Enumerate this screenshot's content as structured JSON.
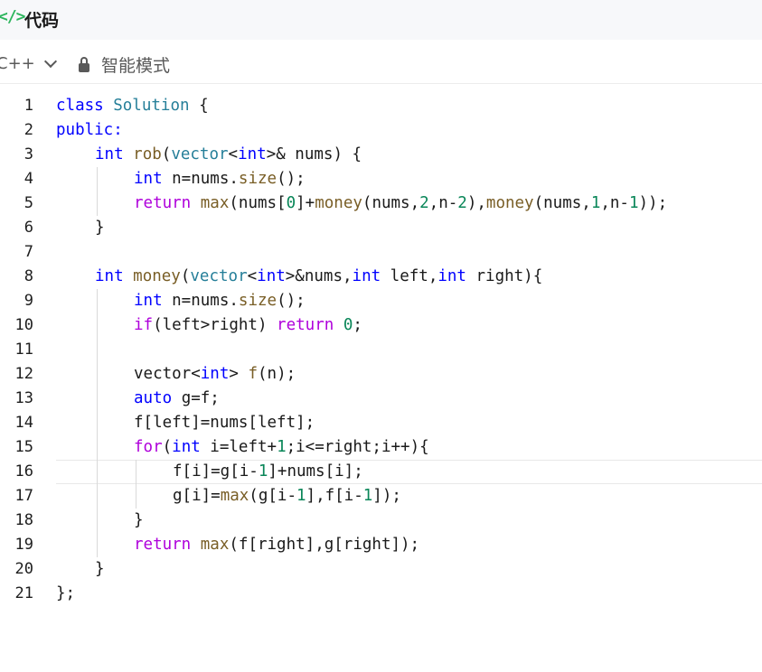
{
  "header": {
    "icon_glyph": "</>",
    "title": "代码"
  },
  "toolbar": {
    "language": "C++",
    "mode_label": "智能模式"
  },
  "editor": {
    "active_line": 16,
    "lines": [
      {
        "num": "1",
        "indent": 0,
        "tokens": [
          [
            "k",
            "class"
          ],
          [
            "p",
            " "
          ],
          [
            "t",
            "Solution"
          ],
          [
            "p",
            " {"
          ]
        ]
      },
      {
        "num": "2",
        "indent": 0,
        "tokens": [
          [
            "k",
            "public:"
          ]
        ]
      },
      {
        "num": "3",
        "indent": 1,
        "tokens": [
          [
            "k",
            "int"
          ],
          [
            "p",
            " "
          ],
          [
            "f",
            "rob"
          ],
          [
            "p",
            "("
          ],
          [
            "t",
            "vector"
          ],
          [
            "p",
            "<"
          ],
          [
            "k",
            "int"
          ],
          [
            "p",
            ">& nums) {"
          ]
        ]
      },
      {
        "num": "4",
        "indent": 2,
        "tokens": [
          [
            "k",
            "int"
          ],
          [
            "p",
            " n=nums."
          ],
          [
            "f",
            "size"
          ],
          [
            "p",
            "();"
          ]
        ]
      },
      {
        "num": "5",
        "indent": 2,
        "tokens": [
          [
            "c",
            "return"
          ],
          [
            "p",
            " "
          ],
          [
            "f",
            "max"
          ],
          [
            "p",
            "(nums["
          ],
          [
            "n",
            "0"
          ],
          [
            "p",
            "]+"
          ],
          [
            "f",
            "money"
          ],
          [
            "p",
            "(nums,"
          ],
          [
            "n",
            "2"
          ],
          [
            "p",
            ",n-"
          ],
          [
            "n",
            "2"
          ],
          [
            "p",
            "),"
          ],
          [
            "f",
            "money"
          ],
          [
            "p",
            "(nums,"
          ],
          [
            "n",
            "1"
          ],
          [
            "p",
            ",n-"
          ],
          [
            "n",
            "1"
          ],
          [
            "p",
            "));"
          ]
        ]
      },
      {
        "num": "6",
        "indent": 1,
        "tokens": [
          [
            "p",
            "}"
          ]
        ]
      },
      {
        "num": "7",
        "indent": 0,
        "tokens": []
      },
      {
        "num": "8",
        "indent": 1,
        "tokens": [
          [
            "k",
            "int"
          ],
          [
            "p",
            " "
          ],
          [
            "f",
            "money"
          ],
          [
            "p",
            "("
          ],
          [
            "t",
            "vector"
          ],
          [
            "p",
            "<"
          ],
          [
            "k",
            "int"
          ],
          [
            "p",
            ">&nums,"
          ],
          [
            "k",
            "int"
          ],
          [
            "p",
            " left,"
          ],
          [
            "k",
            "int"
          ],
          [
            "p",
            " right){"
          ]
        ]
      },
      {
        "num": "9",
        "indent": 2,
        "tokens": [
          [
            "k",
            "int"
          ],
          [
            "p",
            " n=nums."
          ],
          [
            "f",
            "size"
          ],
          [
            "p",
            "();"
          ]
        ]
      },
      {
        "num": "10",
        "indent": 2,
        "tokens": [
          [
            "c",
            "if"
          ],
          [
            "p",
            "(left>right) "
          ],
          [
            "c",
            "return"
          ],
          [
            "p",
            " "
          ],
          [
            "n",
            "0"
          ],
          [
            "p",
            ";"
          ]
        ]
      },
      {
        "num": "11",
        "indent": 0,
        "tokens": []
      },
      {
        "num": "12",
        "indent": 2,
        "tokens": [
          [
            "p",
            "vector<"
          ],
          [
            "k",
            "int"
          ],
          [
            "p",
            "> "
          ],
          [
            "f",
            "f"
          ],
          [
            "p",
            "(n);"
          ]
        ]
      },
      {
        "num": "13",
        "indent": 2,
        "tokens": [
          [
            "k",
            "auto"
          ],
          [
            "p",
            " g=f;"
          ]
        ]
      },
      {
        "num": "14",
        "indent": 2,
        "tokens": [
          [
            "p",
            "f[left]=nums[left];"
          ]
        ]
      },
      {
        "num": "15",
        "indent": 2,
        "tokens": [
          [
            "c",
            "for"
          ],
          [
            "p",
            "("
          ],
          [
            "k",
            "int"
          ],
          [
            "p",
            " i=left+"
          ],
          [
            "n",
            "1"
          ],
          [
            "p",
            ";i<=right;i++){"
          ]
        ]
      },
      {
        "num": "16",
        "indent": 3,
        "tokens": [
          [
            "p",
            "f[i]=g[i-"
          ],
          [
            "n",
            "1"
          ],
          [
            "p",
            "]+nums[i];"
          ]
        ]
      },
      {
        "num": "17",
        "indent": 3,
        "tokens": [
          [
            "p",
            "g[i]="
          ],
          [
            "f",
            "max"
          ],
          [
            "p",
            "(g[i-"
          ],
          [
            "n",
            "1"
          ],
          [
            "p",
            "],f[i-"
          ],
          [
            "n",
            "1"
          ],
          [
            "p",
            "]);"
          ]
        ]
      },
      {
        "num": "18",
        "indent": 2,
        "tokens": [
          [
            "p",
            "}"
          ]
        ]
      },
      {
        "num": "19",
        "indent": 2,
        "tokens": [
          [
            "c",
            "return"
          ],
          [
            "p",
            " "
          ],
          [
            "f",
            "max"
          ],
          [
            "p",
            "(f[right],g[right]);"
          ]
        ]
      },
      {
        "num": "20",
        "indent": 1,
        "tokens": [
          [
            "p",
            "}"
          ]
        ]
      },
      {
        "num": "21",
        "indent": 0,
        "tokens": [
          [
            "p",
            "};"
          ]
        ]
      }
    ]
  }
}
